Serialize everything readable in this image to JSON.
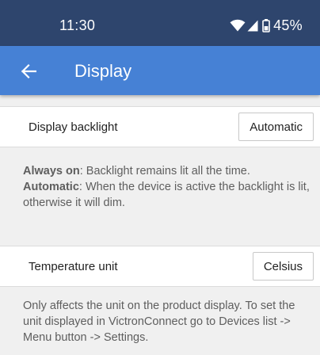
{
  "status_bar": {
    "time": "11:30",
    "battery": "45%",
    "icons": [
      "wifi-icon",
      "cell-signal-icon",
      "battery-icon"
    ]
  },
  "app_bar": {
    "back_icon": "arrow-left-icon",
    "title": "Display"
  },
  "settings": [
    {
      "label": "Display backlight",
      "value": "Automatic"
    },
    {
      "label": "Temperature unit",
      "value": "Celsius"
    }
  ],
  "descriptions": {
    "backlight": {
      "always_on_term": "Always on",
      "always_on_text": ": Backlight remains lit all the time.",
      "automatic_term": "Automatic",
      "automatic_text": ": When the device is active the backlight is lit, otherwise it will dim."
    },
    "temperature": "Only affects the unit on the product display. To set the unit displayed in VictronConnect go to Devices list -> Menu button -> Settings."
  },
  "colors": {
    "status_bar": "#2e456d",
    "app_bar": "#4681d5",
    "background": "#f0f0f0"
  }
}
